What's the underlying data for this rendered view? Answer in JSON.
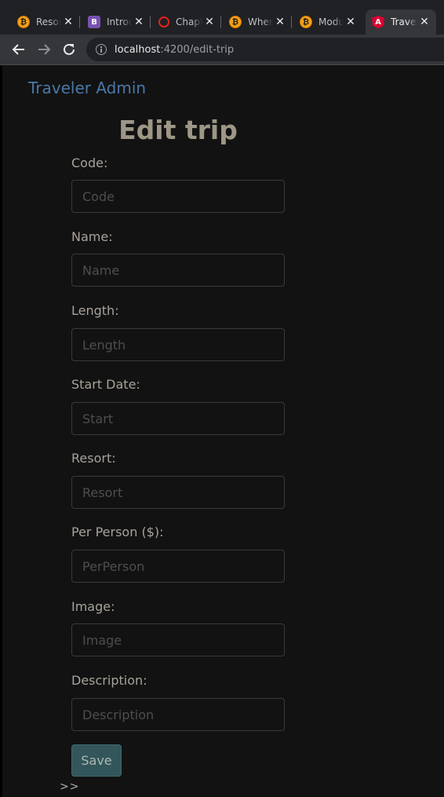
{
  "browser": {
    "tabs": [
      {
        "title": "Resorts",
        "favicon": "b-orange"
      },
      {
        "title": "Introduction",
        "favicon": "b-purple"
      },
      {
        "title": "Chapter",
        "favicon": "o-red"
      },
      {
        "title": "Where",
        "favicon": "b-orange"
      },
      {
        "title": "Modules",
        "favicon": "b-orange"
      },
      {
        "title": "Travel",
        "favicon": "angular",
        "active": true
      }
    ],
    "url_host": "localhost",
    "url_path": ":4200/edit-trip"
  },
  "page": {
    "brand": "Traveler Admin",
    "title": "Edit trip",
    "fields": [
      {
        "label": "Code:",
        "placeholder": "Code",
        "value": ""
      },
      {
        "label": "Name:",
        "placeholder": "Name",
        "value": ""
      },
      {
        "label": "Length:",
        "placeholder": "Length",
        "value": ""
      },
      {
        "label": "Start Date:",
        "placeholder": "Start",
        "value": ""
      },
      {
        "label": "Resort:",
        "placeholder": "Resort",
        "value": ""
      },
      {
        "label": "Per Person ($):",
        "placeholder": "PerPerson",
        "value": ""
      },
      {
        "label": "Image:",
        "placeholder": "Image",
        "value": ""
      },
      {
        "label": "Description:",
        "placeholder": "Description",
        "value": ""
      }
    ],
    "save_label": "Save",
    "footer_mark": ">>"
  },
  "colors": {
    "background": "#121212",
    "brand": "#4a78a8",
    "title": "#9e9686",
    "save_button": "#32565a"
  }
}
